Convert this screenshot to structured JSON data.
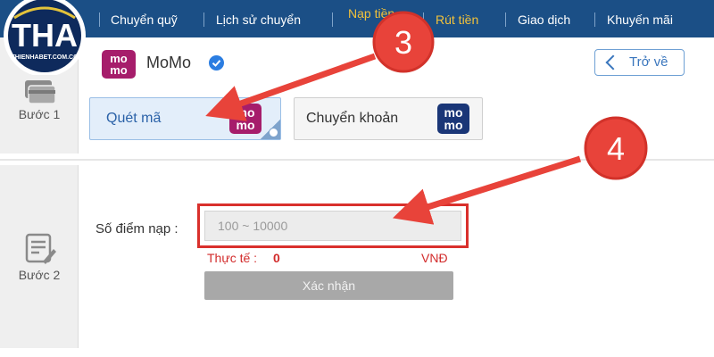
{
  "nav": {
    "items": [
      {
        "label": "Chuyển quỹ"
      },
      {
        "label": "Lịch sử chuyển"
      },
      {
        "label": "Nạp tiền"
      },
      {
        "label": "Rút tiền"
      },
      {
        "label": "Giao dịch"
      },
      {
        "label": "Khuyến mãi"
      }
    ],
    "active_color": "#f3c23a",
    "background": "#1b4f86"
  },
  "logo": {
    "text": "THA",
    "domain": "THIENHABET.COM.CO",
    "colors": {
      "ring": "#ffffff",
      "inner": "#0e2a5c",
      "accent": "#e3c23a"
    }
  },
  "steps": [
    {
      "label": "Bước 1",
      "icon": "payment-card-icon"
    },
    {
      "label": "Bước 2",
      "icon": "form-edit-icon"
    }
  ],
  "provider": {
    "name": "MoMo",
    "logo_text": "mo mo",
    "verified_icon": "check-circle-icon",
    "brand_color": "#a61d6b"
  },
  "back_button": {
    "label": "Trở về",
    "icon": "chevron-left-icon"
  },
  "methods": [
    {
      "label": "Quét mã",
      "selected": true,
      "logo_text": "mo mo",
      "logo_color": "#a61d6b"
    },
    {
      "label": "Chuyển khoản",
      "selected": false,
      "logo_text": "mo mo",
      "logo_color": "#1a3677"
    }
  ],
  "form": {
    "amount_label": "Số điểm nạp :",
    "amount_placeholder": "100 ~ 10000",
    "amount_value": "",
    "actual_label": "Thực tế :",
    "actual_value": "0",
    "currency": "VNĐ",
    "confirm_label": "Xác nhận"
  },
  "annotations": [
    {
      "number": "3",
      "points_to": "Quét mã"
    },
    {
      "number": "4",
      "points_to": "Số điểm nạp"
    }
  ],
  "colors": {
    "annotation": "#e8433a",
    "highlight_border": "#d9302c",
    "error_text": "#d22b2b"
  }
}
